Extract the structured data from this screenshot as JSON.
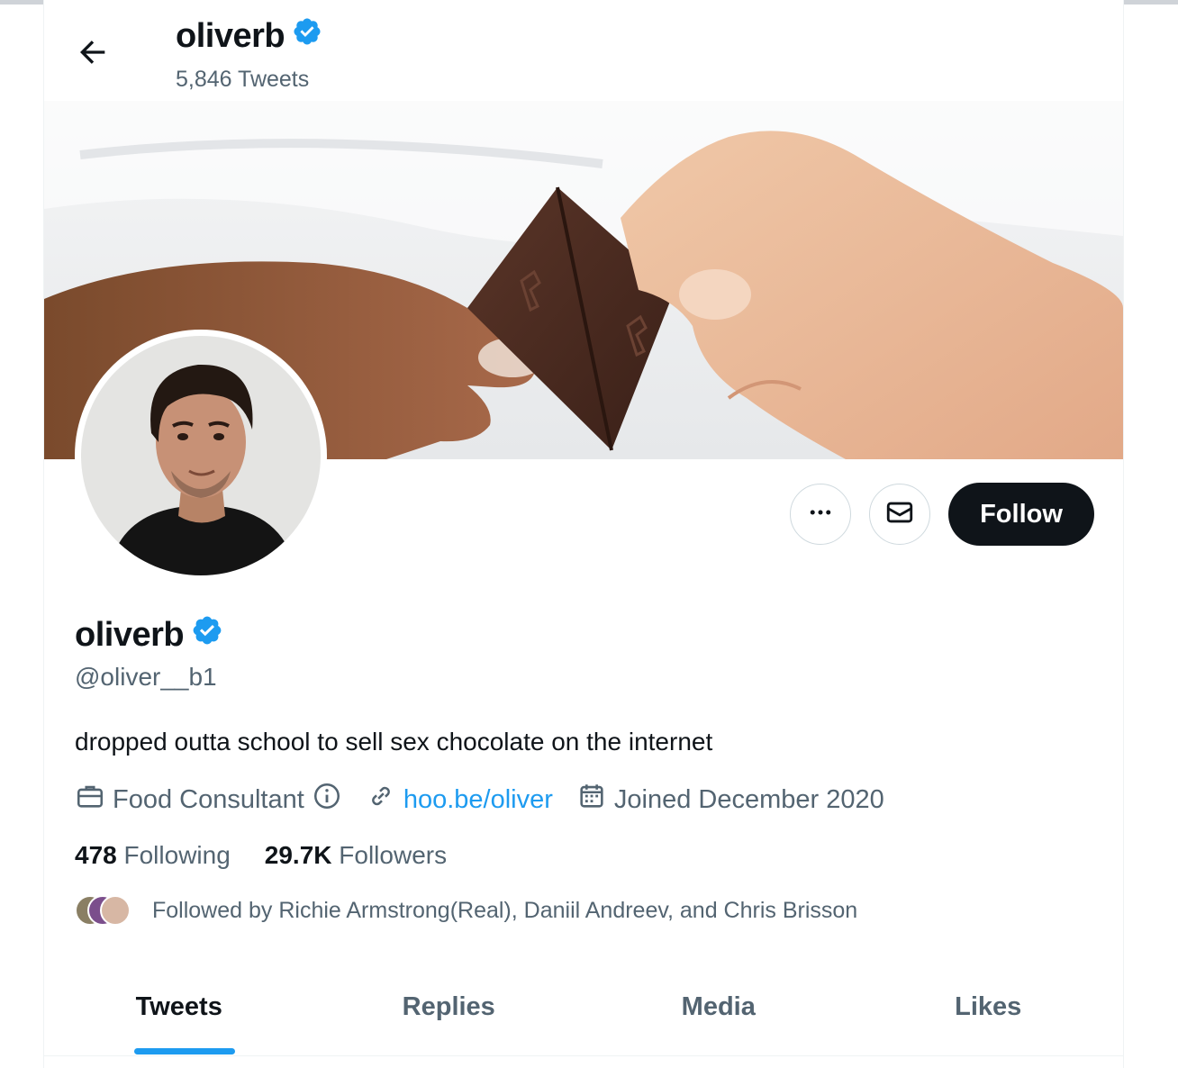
{
  "header": {
    "name": "oliverb",
    "tweet_count": "5,846 Tweets"
  },
  "profile": {
    "display_name": "oliverb",
    "handle": "@oliver__b1",
    "bio": "dropped outta school to sell sex chocolate on the internet",
    "category": "Food Consultant",
    "website": "hoo.be/oliver",
    "joined": "Joined December 2020",
    "following_count": "478",
    "following_label": "Following",
    "followers_count": "29.7K",
    "followers_label": "Followers",
    "followed_by": "Followed by Richie Armstrong(Real), Daniil Andreev, and Chris Brisson"
  },
  "actions": {
    "follow_label": "Follow"
  },
  "tabs": [
    {
      "label": "Tweets",
      "active": true
    },
    {
      "label": "Replies",
      "active": false
    },
    {
      "label": "Media",
      "active": false
    },
    {
      "label": "Likes",
      "active": false
    }
  ],
  "icons": {
    "back": "arrow-left-icon",
    "verified": "verified-badge-icon",
    "more": "more-horizontal-icon",
    "message": "envelope-icon",
    "category": "briefcase-icon",
    "info": "info-icon",
    "link": "link-icon",
    "calendar": "calendar-icon"
  },
  "colors": {
    "accent": "#1d9bf0",
    "text": "#0f1419",
    "secondary": "#536471",
    "follow_bg": "#0f1419"
  }
}
